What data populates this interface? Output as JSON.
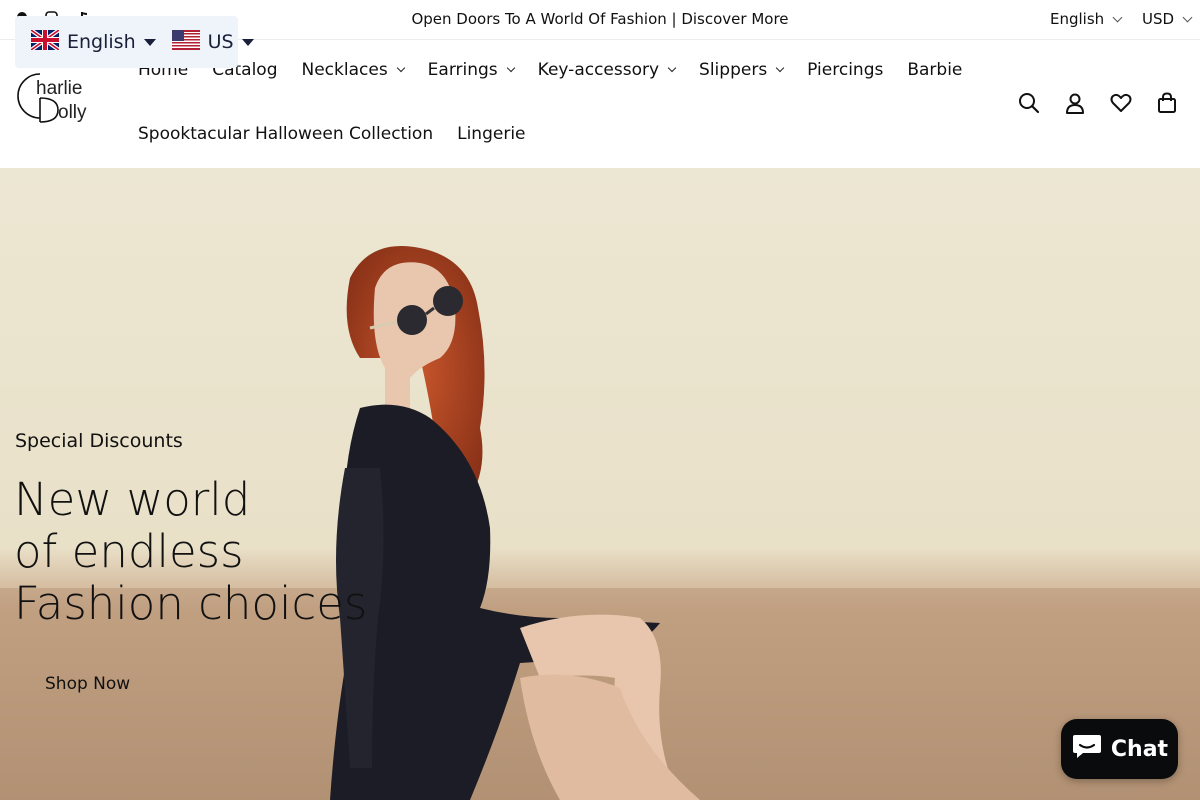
{
  "announcement": {
    "message": "Open Doors To A World Of Fashion | Discover More",
    "language": "English",
    "currency": "USD",
    "social_icons": [
      "facebook-icon",
      "instagram-icon",
      "tiktok-icon"
    ]
  },
  "language_widget": {
    "language": "English",
    "flag_language": "uk-flag-icon",
    "country": "US",
    "flag_country": "us-flag-icon"
  },
  "header": {
    "logo_alt": "Charlie Dolly",
    "nav_row1": [
      {
        "label": "Home",
        "dropdown": false
      },
      {
        "label": "Catalog",
        "dropdown": false
      },
      {
        "label": "Necklaces",
        "dropdown": true
      },
      {
        "label": "Earrings",
        "dropdown": true
      },
      {
        "label": "Key-accessory",
        "dropdown": true
      },
      {
        "label": "Slippers",
        "dropdown": true
      },
      {
        "label": "Piercings",
        "dropdown": false
      },
      {
        "label": "Barbie",
        "dropdown": false
      }
    ],
    "nav_row2": [
      {
        "label": "Spooktacular Halloween Collection",
        "dropdown": false
      },
      {
        "label": "Lingerie",
        "dropdown": false
      }
    ],
    "icons": [
      "search-icon",
      "account-icon",
      "wishlist-icon",
      "cart-icon"
    ]
  },
  "hero": {
    "kicker": "Special Discounts",
    "headline": [
      "New world",
      "of endless",
      "Fashion choices"
    ],
    "cta": "Shop Now"
  },
  "chat": {
    "label": "Chat",
    "background": "#0a0b0d"
  },
  "colors": {
    "text": "#111111",
    "widget_bg": "#eef4fa",
    "widget_text": "#1a1f3a"
  }
}
